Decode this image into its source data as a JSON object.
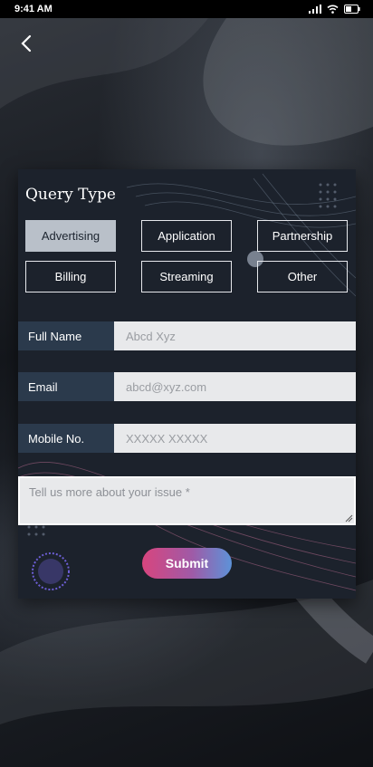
{
  "status_bar": {
    "time": "9:41 AM"
  },
  "form": {
    "title": "Query Type",
    "query_types": [
      {
        "label": "Advertising",
        "selected": true
      },
      {
        "label": "Application",
        "selected": false
      },
      {
        "label": "Partnership",
        "selected": false
      },
      {
        "label": "Billing",
        "selected": false
      },
      {
        "label": "Streaming",
        "selected": false
      },
      {
        "label": "Other",
        "selected": false
      }
    ],
    "fields": {
      "full_name": {
        "label": "Full Name",
        "placeholder": "Abcd Xyz"
      },
      "email": {
        "label": "Email",
        "placeholder": "abcd@xyz.com"
      },
      "mobile": {
        "label": "Mobile No.",
        "placeholder": "XXXXX XXXXX"
      }
    },
    "issue_placeholder": "Tell us more about your issue *",
    "submit_label": "Submit"
  },
  "colors": {
    "card_bg": "#1c222c",
    "label_bg": "#2b3a4c",
    "selected_chip": "#b9c0c9",
    "submit_gradient": [
      "#d8457e",
      "#5d92d8"
    ]
  },
  "icons": [
    "back-arrow",
    "signal",
    "wifi",
    "battery"
  ]
}
